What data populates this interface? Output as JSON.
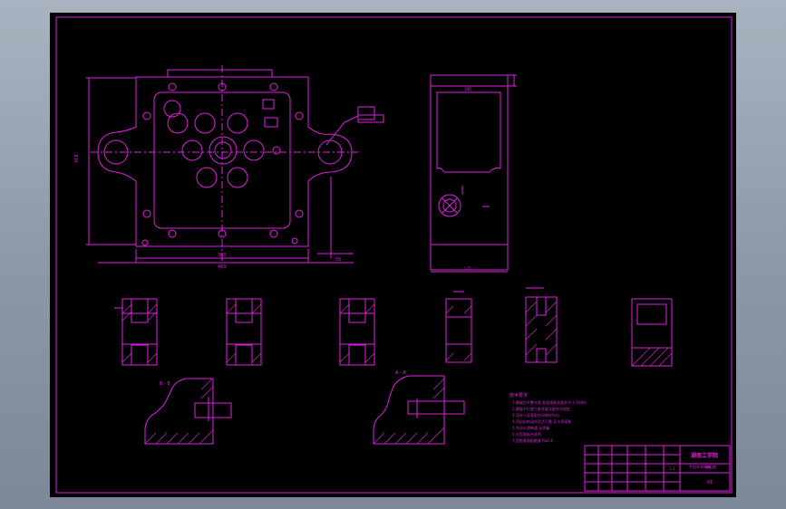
{
  "drawing": {
    "line_color": "#e020e0",
    "background_color": "#000000",
    "viewport_color": "#8e99a8",
    "dimensions": {
      "left_height": "418",
      "bottom_width": "380",
      "bottom_total": "460",
      "right_offset": "55",
      "side_top": "190",
      "side_bottom": "135"
    },
    "section_labels": {
      "section_b": "B - B",
      "section_a": "A - A"
    },
    "notes_title": "技术要求",
    "notes": [
      "1.模架应平整光滑,各连接配合面积不小于80%",
      "2.模架平行度与垂直度误差符合规定",
      "3.导柱与导套配合间隙应均匀",
      "4.顶出机构动作灵活可靠,无卡滞现象",
      "5.冷却水道畅通,无渗漏",
      "6.分型面贴合紧密",
      "7.型腔表面粗糙度 Ra0.4"
    ],
    "title_block": {
      "school": "湖南工学院",
      "drawing_name": "手机外壳模具",
      "sheet_label": "装配图",
      "scale": "1:1",
      "sheet": "01"
    }
  }
}
